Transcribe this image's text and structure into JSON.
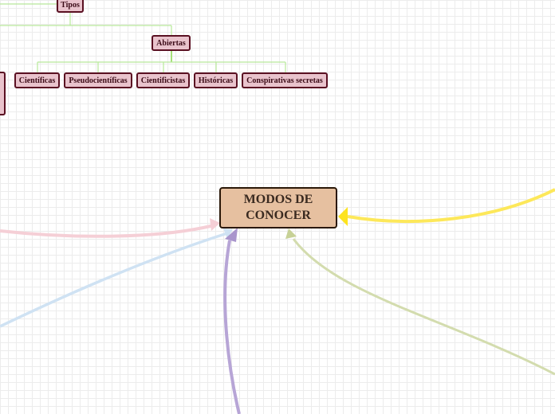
{
  "central_topic": {
    "label": "MODOS DE\nCONOCER",
    "fill": "#e6c0a0"
  },
  "subtopics": {
    "tipos": {
      "label": "Tipos"
    },
    "abiertas": {
      "label": "Abiertas"
    },
    "children": [
      {
        "label": "Científicas"
      },
      {
        "label": "Pseudocientíficas"
      },
      {
        "label": "Cientificistas"
      },
      {
        "label": "Históricas"
      },
      {
        "label": "Conspirativas secretas"
      }
    ]
  },
  "colors": {
    "node_fill": "#e9c3cc",
    "node_border": "#5a1022",
    "connector": "#b7e89a",
    "branch_pink": "#f5cfd6",
    "branch_blue": "#cfe2f3",
    "branch_purple": "#b7a5d6",
    "branch_olive": "#d3dcae",
    "branch_yellow": "#fde85a"
  }
}
